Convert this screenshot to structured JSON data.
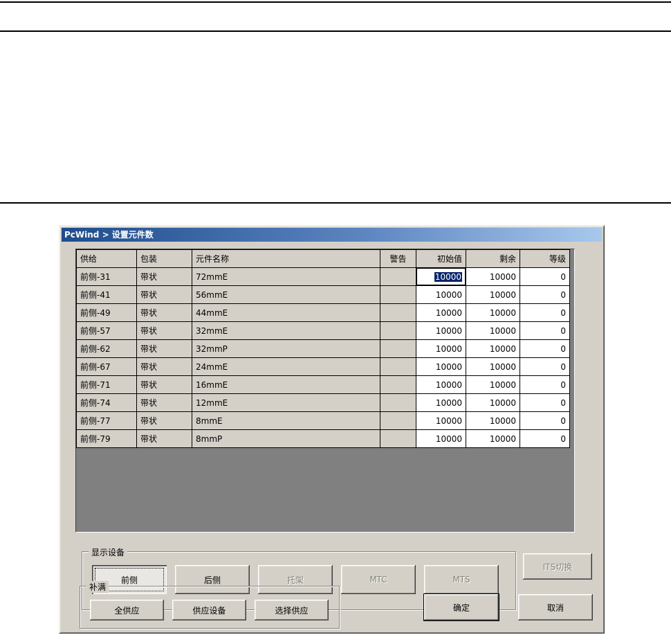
{
  "window": {
    "title": "PcWind > 设置元件数"
  },
  "table": {
    "columns": [
      "供给",
      "包装",
      "元件名称",
      "警告",
      "初始值",
      "剩余",
      "等级"
    ],
    "rows": [
      [
        "前侧-31",
        "带状",
        "72mmE",
        "",
        "10000",
        "10000",
        "0"
      ],
      [
        "前侧-41",
        "带状",
        "56mmE",
        "",
        "10000",
        "10000",
        "0"
      ],
      [
        "前侧-49",
        "带状",
        "44mmE",
        "",
        "10000",
        "10000",
        "0"
      ],
      [
        "前侧-57",
        "带状",
        "32mmE",
        "",
        "10000",
        "10000",
        "0"
      ],
      [
        "前侧-62",
        "带状",
        "32mmP",
        "",
        "10000",
        "10000",
        "0"
      ],
      [
        "前侧-67",
        "带状",
        "24mmE",
        "",
        "10000",
        "10000",
        "0"
      ],
      [
        "前侧-71",
        "带状",
        "16mmE",
        "",
        "10000",
        "10000",
        "0"
      ],
      [
        "前侧-74",
        "带状",
        "12mmE",
        "",
        "10000",
        "10000",
        "0"
      ],
      [
        "前侧-77",
        "带状",
        "8mmE",
        "",
        "10000",
        "10000",
        "0"
      ],
      [
        "前侧-79",
        "带状",
        "8mmP",
        "",
        "10000",
        "10000",
        "0"
      ]
    ],
    "editing": {
      "row": 0,
      "col": 4,
      "selected_value": "10000"
    }
  },
  "display_group": {
    "label": "显示设备",
    "buttons": [
      {
        "name": "front",
        "label": "前侧",
        "state": "pressed"
      },
      {
        "name": "rear",
        "label": "后侧",
        "state": "normal"
      },
      {
        "name": "tray",
        "label": "托架",
        "state": "disabled"
      },
      {
        "name": "mtc",
        "label": "MTC",
        "state": "disabled"
      },
      {
        "name": "mts",
        "label": "MTS",
        "state": "disabled"
      }
    ]
  },
  "its_button": {
    "label": "ITS切换",
    "state": "disabled"
  },
  "refill_group": {
    "label": "补满",
    "buttons": [
      {
        "name": "supply-all",
        "label": "全供应",
        "state": "normal"
      },
      {
        "name": "supply-device",
        "label": "供应设备",
        "state": "normal"
      },
      {
        "name": "select-supply",
        "label": "选择供应",
        "state": "normal"
      }
    ]
  },
  "actions": {
    "ok": "确定",
    "cancel": "取消"
  }
}
